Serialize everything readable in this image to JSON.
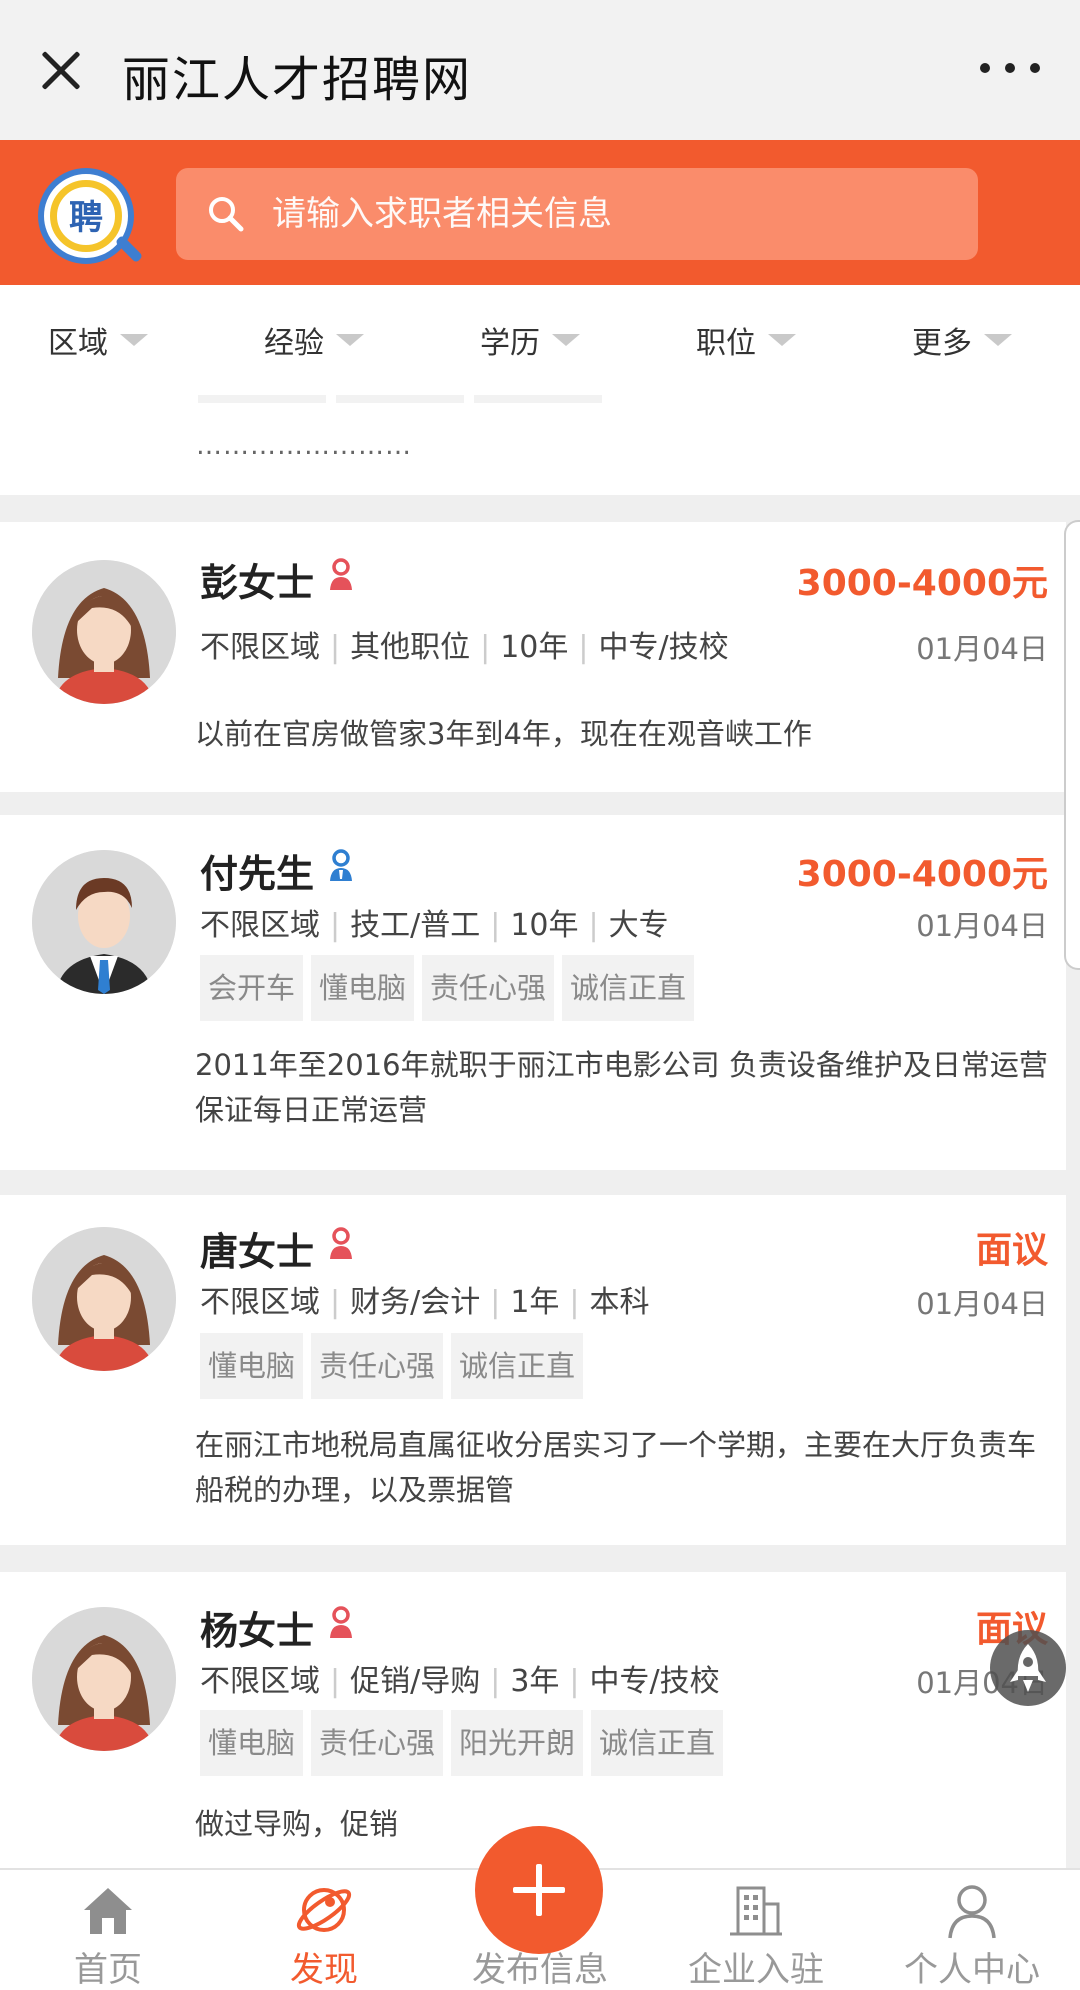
{
  "window": {
    "title": "丽江人才招聘网"
  },
  "header": {
    "logo_text": "聘",
    "search_placeholder": "请输入求职者相关信息"
  },
  "filters": [
    "区域",
    "经验",
    "学历",
    "职位",
    "更多"
  ],
  "partial_card": {
    "dots": "……………………"
  },
  "candidates": [
    {
      "name": "彭女士",
      "gender": "female",
      "salary": "3000-4000元",
      "area": "不限区域",
      "position": "其他职位",
      "experience": "10年",
      "education": "中专/技校",
      "date": "01月04日",
      "tags": [],
      "desc": "以前在官房做管家3年到4年，现在在观音峡工作"
    },
    {
      "name": "付先生",
      "gender": "male",
      "salary": "3000-4000元",
      "area": "不限区域",
      "position": "技工/普工",
      "experience": "10年",
      "education": "大专",
      "date": "01月04日",
      "tags": [
        "会开车",
        "懂电脑",
        "责任心强",
        "诚信正直"
      ],
      "desc": "2011年至2016年就职于丽江市电影公司 负责设备维护及日常运营 保证每日正常运营"
    },
    {
      "name": "唐女士",
      "gender": "female",
      "salary": "面议",
      "area": "不限区域",
      "position": "财务/会计",
      "experience": "1年",
      "education": "本科",
      "date": "01月04日",
      "tags": [
        "懂电脑",
        "责任心强",
        "诚信正直"
      ],
      "desc": "在丽江市地税局直属征收分居实习了一个学期，主要在大厅负责车船税的办理，以及票据管"
    },
    {
      "name": "杨女士",
      "gender": "female",
      "salary": "面议",
      "area": "不限区域",
      "position": "促销/导购",
      "experience": "3年",
      "education": "中专/技校",
      "date": "01月04日",
      "tags": [
        "懂电脑",
        "责任心强",
        "阳光开朗",
        "诚信正直"
      ],
      "desc": "做过导购，促销"
    }
  ],
  "nav": [
    {
      "label": "首页",
      "icon": "home-icon",
      "active": false
    },
    {
      "label": "发现",
      "icon": "discover-icon",
      "active": true
    },
    {
      "label": "发布信息",
      "icon": "plus-icon",
      "active": false
    },
    {
      "label": "企业入驻",
      "icon": "building-icon",
      "active": false
    },
    {
      "label": "个人中心",
      "icon": "person-icon",
      "active": false
    }
  ],
  "colors": {
    "accent": "#f25a2e",
    "female": "#e5525a",
    "male": "#2f7fd1"
  }
}
